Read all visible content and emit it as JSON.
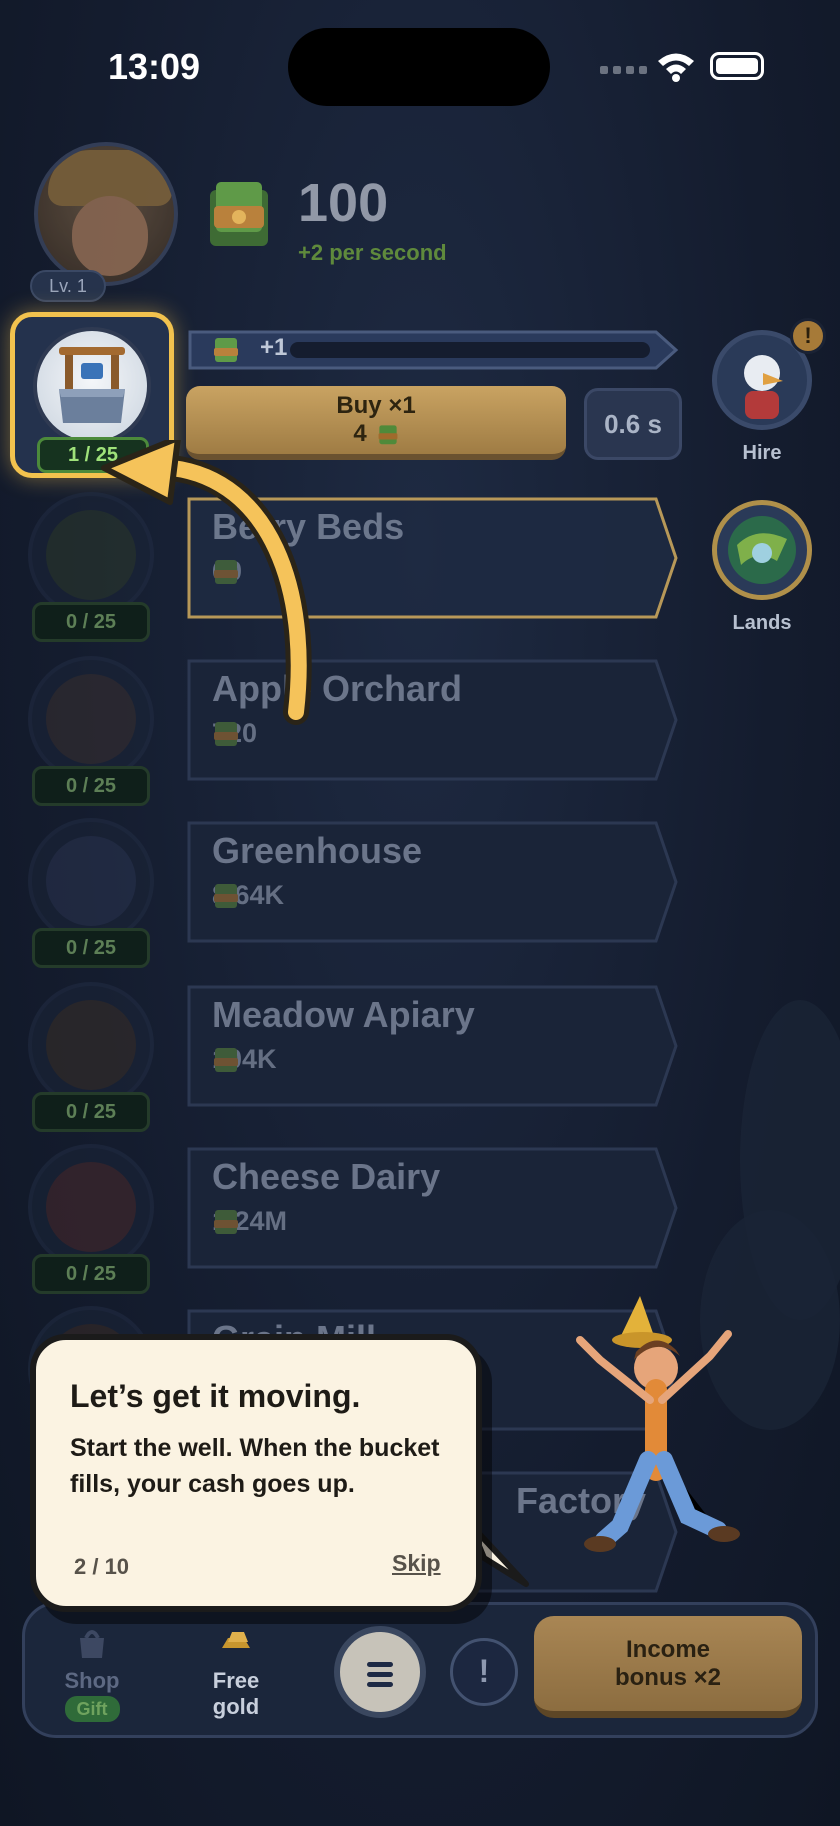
{
  "status_bar": {
    "time": "13:09"
  },
  "profile": {
    "level_label": "Lv. 1"
  },
  "money": {
    "amount": "100",
    "rate": "+2 per second"
  },
  "active_business": {
    "count": "1 / 25",
    "increment": "+1",
    "progress_fraction": 0,
    "buy_label": "Buy ×1",
    "buy_cost": "4",
    "cycle_time": "0.6 s"
  },
  "businesses": [
    {
      "name": "Berry Beds",
      "cost": "60",
      "count": "0 / 25"
    },
    {
      "name": "Apple Orchard",
      "cost": "720",
      "count": "0 / 25"
    },
    {
      "name": "Greenhouse",
      "cost": "8.64K",
      "count": "0 / 25"
    },
    {
      "name": "Meadow Apiary",
      "cost": "104K",
      "count": "0 / 25"
    },
    {
      "name": "Cheese Dairy",
      "cost": "1.24M",
      "count": "0 / 25"
    },
    {
      "name": "Grain Mill"
    },
    {
      "name": "Factory"
    }
  ],
  "side": {
    "hire_label": "Hire",
    "hire_badge": "!",
    "lands_label": "Lands"
  },
  "bottom_nav": {
    "shop_label": "Shop",
    "gift_label": "Gift",
    "free_gold_label": "Free gold",
    "alert_glyph": "!",
    "income_label": "Income bonus ×2"
  },
  "tutorial": {
    "title": "Let’s get it moving.",
    "text": "Start the well. When the bucket fills, your cash goes up.",
    "step": "2 / 10",
    "skip_label": "Skip"
  },
  "colors": {
    "accent_gold": "#f2c24e",
    "count_green": "#9fe27a",
    "rate_green": "#5f8a3c"
  },
  "icons": [
    "money-icon",
    "well-icon",
    "wifi-icon",
    "battery-icon",
    "menu-icon",
    "alert-icon",
    "gold-bar-icon",
    "shop-icon"
  ]
}
